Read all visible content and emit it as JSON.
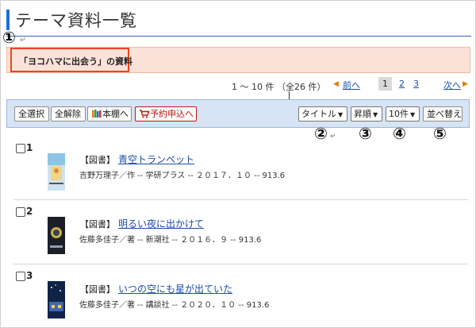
{
  "page": {
    "title": "テーマ資料一覧",
    "accent_color": "#1e6fd9"
  },
  "annotations": {
    "one": "①",
    "two": "②",
    "three": "③",
    "four": "④",
    "five": "⑤",
    "return_mark": "↵"
  },
  "theme": {
    "label": "「ヨコハマに出会う」の資料"
  },
  "pagination": {
    "range_text": "1 ～ 10 件 （全26 件）",
    "prev_arrow": "◀",
    "prev_label": "前へ",
    "pages": [
      "1",
      "2",
      "3"
    ],
    "current_page": "1",
    "next_label": "次へ",
    "next_arrow": "▶"
  },
  "toolbar": {
    "select_all": "全選択",
    "clear_all": "全解除",
    "to_shelf": "本棚へ",
    "shelf_icon": "bookshelf-icon",
    "reserve": "予約申込へ",
    "reserve_icon": "cart-icon",
    "sort_field": "タイトル",
    "sort_order": "昇順",
    "per_page": "10件",
    "sort_button": "並べ替え",
    "dropdown_icon": "chevron-down-icon"
  },
  "results": [
    {
      "number": "1",
      "type": "【図書】",
      "title": "青空トランペット",
      "info": "吉野万理子／作 -- 学研プラス -- ２０１７．１０ -- 913.6"
    },
    {
      "number": "2",
      "type": "【図書】",
      "title": "明るい夜に出かけて",
      "info": "佐藤多佳子／著 -- 新潮社 -- ２０１６．９ -- 913.6"
    },
    {
      "number": "3",
      "type": "【図書】",
      "title": "いつの空にも星が出ていた",
      "info": "佐藤多佳子／著 -- 講談社 -- ２０２０．１０ -- 913.6"
    }
  ]
}
